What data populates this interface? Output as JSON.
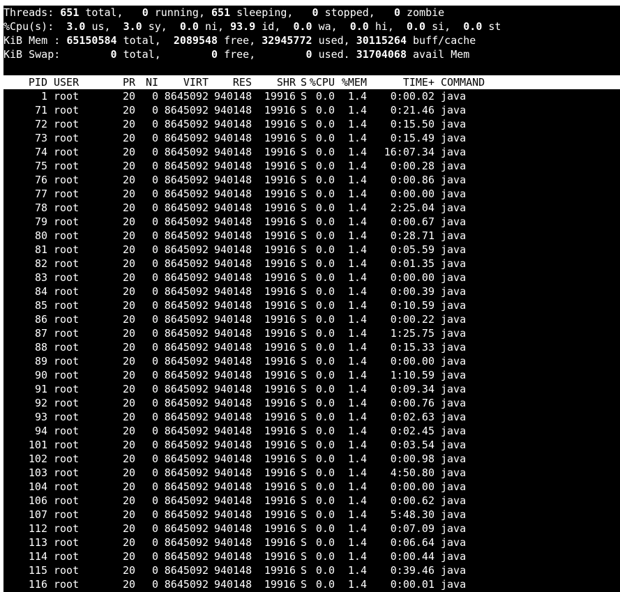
{
  "summary": {
    "threads": {
      "label": "Threads:",
      "total": "651",
      "total_label": "total,",
      "running": "0",
      "running_label": "running,",
      "sleeping": "651",
      "sleeping_label": "sleeping,",
      "stopped": "0",
      "stopped_label": "stopped,",
      "zombie": "0",
      "zombie_label": "zombie"
    },
    "cpu": {
      "label": "%Cpu(s):",
      "us": "3.0",
      "us_label": "us,",
      "sy": "3.0",
      "sy_label": "sy,",
      "ni": "0.0",
      "ni_label": "ni,",
      "id": "93.9",
      "id_label": "id,",
      "wa": "0.0",
      "wa_label": "wa,",
      "hi": "0.0",
      "hi_label": "hi,",
      "si": "0.0",
      "si_label": "si,",
      "st": "0.0",
      "st_label": "st"
    },
    "mem": {
      "label": "KiB Mem :",
      "total": "65150584",
      "total_label": "total,",
      "free": "2089548",
      "free_label": "free,",
      "used": "32945772",
      "used_label": "used,",
      "buff": "30115264",
      "buff_label": "buff/cache"
    },
    "swap": {
      "label": "KiB Swap:",
      "total": "0",
      "total_label": "total,",
      "free": "0",
      "free_label": "free,",
      "used": "0",
      "used_label": "used.",
      "avail": "31704068",
      "avail_label": "avail Mem"
    }
  },
  "columns": [
    "PID",
    "USER",
    "PR",
    "NI",
    "VIRT",
    "RES",
    "SHR",
    "S",
    "%CPU",
    "%MEM",
    "TIME+",
    "COMMAND"
  ],
  "rows": [
    [
      "1",
      "root",
      "20",
      "0",
      "8645092",
      "940148",
      "19916",
      "S",
      "0.0",
      "1.4",
      "0:00.02",
      "java"
    ],
    [
      "71",
      "root",
      "20",
      "0",
      "8645092",
      "940148",
      "19916",
      "S",
      "0.0",
      "1.4",
      "0:21.46",
      "java"
    ],
    [
      "72",
      "root",
      "20",
      "0",
      "8645092",
      "940148",
      "19916",
      "S",
      "0.0",
      "1.4",
      "0:15.50",
      "java"
    ],
    [
      "73",
      "root",
      "20",
      "0",
      "8645092",
      "940148",
      "19916",
      "S",
      "0.0",
      "1.4",
      "0:15.49",
      "java"
    ],
    [
      "74",
      "root",
      "20",
      "0",
      "8645092",
      "940148",
      "19916",
      "S",
      "0.0",
      "1.4",
      "16:07.34",
      "java"
    ],
    [
      "75",
      "root",
      "20",
      "0",
      "8645092",
      "940148",
      "19916",
      "S",
      "0.0",
      "1.4",
      "0:00.28",
      "java"
    ],
    [
      "76",
      "root",
      "20",
      "0",
      "8645092",
      "940148",
      "19916",
      "S",
      "0.0",
      "1.4",
      "0:00.86",
      "java"
    ],
    [
      "77",
      "root",
      "20",
      "0",
      "8645092",
      "940148",
      "19916",
      "S",
      "0.0",
      "1.4",
      "0:00.00",
      "java"
    ],
    [
      "78",
      "root",
      "20",
      "0",
      "8645092",
      "940148",
      "19916",
      "S",
      "0.0",
      "1.4",
      "2:25.04",
      "java"
    ],
    [
      "79",
      "root",
      "20",
      "0",
      "8645092",
      "940148",
      "19916",
      "S",
      "0.0",
      "1.4",
      "0:00.67",
      "java"
    ],
    [
      "80",
      "root",
      "20",
      "0",
      "8645092",
      "940148",
      "19916",
      "S",
      "0.0",
      "1.4",
      "0:28.71",
      "java"
    ],
    [
      "81",
      "root",
      "20",
      "0",
      "8645092",
      "940148",
      "19916",
      "S",
      "0.0",
      "1.4",
      "0:05.59",
      "java"
    ],
    [
      "82",
      "root",
      "20",
      "0",
      "8645092",
      "940148",
      "19916",
      "S",
      "0.0",
      "1.4",
      "0:01.35",
      "java"
    ],
    [
      "83",
      "root",
      "20",
      "0",
      "8645092",
      "940148",
      "19916",
      "S",
      "0.0",
      "1.4",
      "0:00.00",
      "java"
    ],
    [
      "84",
      "root",
      "20",
      "0",
      "8645092",
      "940148",
      "19916",
      "S",
      "0.0",
      "1.4",
      "0:00.39",
      "java"
    ],
    [
      "85",
      "root",
      "20",
      "0",
      "8645092",
      "940148",
      "19916",
      "S",
      "0.0",
      "1.4",
      "0:10.59",
      "java"
    ],
    [
      "86",
      "root",
      "20",
      "0",
      "8645092",
      "940148",
      "19916",
      "S",
      "0.0",
      "1.4",
      "0:00.22",
      "java"
    ],
    [
      "87",
      "root",
      "20",
      "0",
      "8645092",
      "940148",
      "19916",
      "S",
      "0.0",
      "1.4",
      "1:25.75",
      "java"
    ],
    [
      "88",
      "root",
      "20",
      "0",
      "8645092",
      "940148",
      "19916",
      "S",
      "0.0",
      "1.4",
      "0:15.33",
      "java"
    ],
    [
      "89",
      "root",
      "20",
      "0",
      "8645092",
      "940148",
      "19916",
      "S",
      "0.0",
      "1.4",
      "0:00.00",
      "java"
    ],
    [
      "90",
      "root",
      "20",
      "0",
      "8645092",
      "940148",
      "19916",
      "S",
      "0.0",
      "1.4",
      "1:10.59",
      "java"
    ],
    [
      "91",
      "root",
      "20",
      "0",
      "8645092",
      "940148",
      "19916",
      "S",
      "0.0",
      "1.4",
      "0:09.34",
      "java"
    ],
    [
      "92",
      "root",
      "20",
      "0",
      "8645092",
      "940148",
      "19916",
      "S",
      "0.0",
      "1.4",
      "0:00.76",
      "java"
    ],
    [
      "93",
      "root",
      "20",
      "0",
      "8645092",
      "940148",
      "19916",
      "S",
      "0.0",
      "1.4",
      "0:02.63",
      "java"
    ],
    [
      "94",
      "root",
      "20",
      "0",
      "8645092",
      "940148",
      "19916",
      "S",
      "0.0",
      "1.4",
      "0:02.45",
      "java"
    ],
    [
      "101",
      "root",
      "20",
      "0",
      "8645092",
      "940148",
      "19916",
      "S",
      "0.0",
      "1.4",
      "0:03.54",
      "java"
    ],
    [
      "102",
      "root",
      "20",
      "0",
      "8645092",
      "940148",
      "19916",
      "S",
      "0.0",
      "1.4",
      "0:00.98",
      "java"
    ],
    [
      "103",
      "root",
      "20",
      "0",
      "8645092",
      "940148",
      "19916",
      "S",
      "0.0",
      "1.4",
      "4:50.80",
      "java"
    ],
    [
      "104",
      "root",
      "20",
      "0",
      "8645092",
      "940148",
      "19916",
      "S",
      "0.0",
      "1.4",
      "0:00.00",
      "java"
    ],
    [
      "106",
      "root",
      "20",
      "0",
      "8645092",
      "940148",
      "19916",
      "S",
      "0.0",
      "1.4",
      "0:00.62",
      "java"
    ],
    [
      "107",
      "root",
      "20",
      "0",
      "8645092",
      "940148",
      "19916",
      "S",
      "0.0",
      "1.4",
      "5:48.30",
      "java"
    ],
    [
      "112",
      "root",
      "20",
      "0",
      "8645092",
      "940148",
      "19916",
      "S",
      "0.0",
      "1.4",
      "0:07.09",
      "java"
    ],
    [
      "113",
      "root",
      "20",
      "0",
      "8645092",
      "940148",
      "19916",
      "S",
      "0.0",
      "1.4",
      "0:06.64",
      "java"
    ],
    [
      "114",
      "root",
      "20",
      "0",
      "8645092",
      "940148",
      "19916",
      "S",
      "0.0",
      "1.4",
      "0:00.44",
      "java"
    ],
    [
      "115",
      "root",
      "20",
      "0",
      "8645092",
      "940148",
      "19916",
      "S",
      "0.0",
      "1.4",
      "0:39.46",
      "java"
    ],
    [
      "116",
      "root",
      "20",
      "0",
      "8645092",
      "940148",
      "19916",
      "S",
      "0.0",
      "1.4",
      "0:00.01",
      "java"
    ]
  ],
  "colors": {
    "background": "#000000",
    "foreground": "#ffffff",
    "header_bg": "#ffffff",
    "header_fg": "#000000"
  }
}
